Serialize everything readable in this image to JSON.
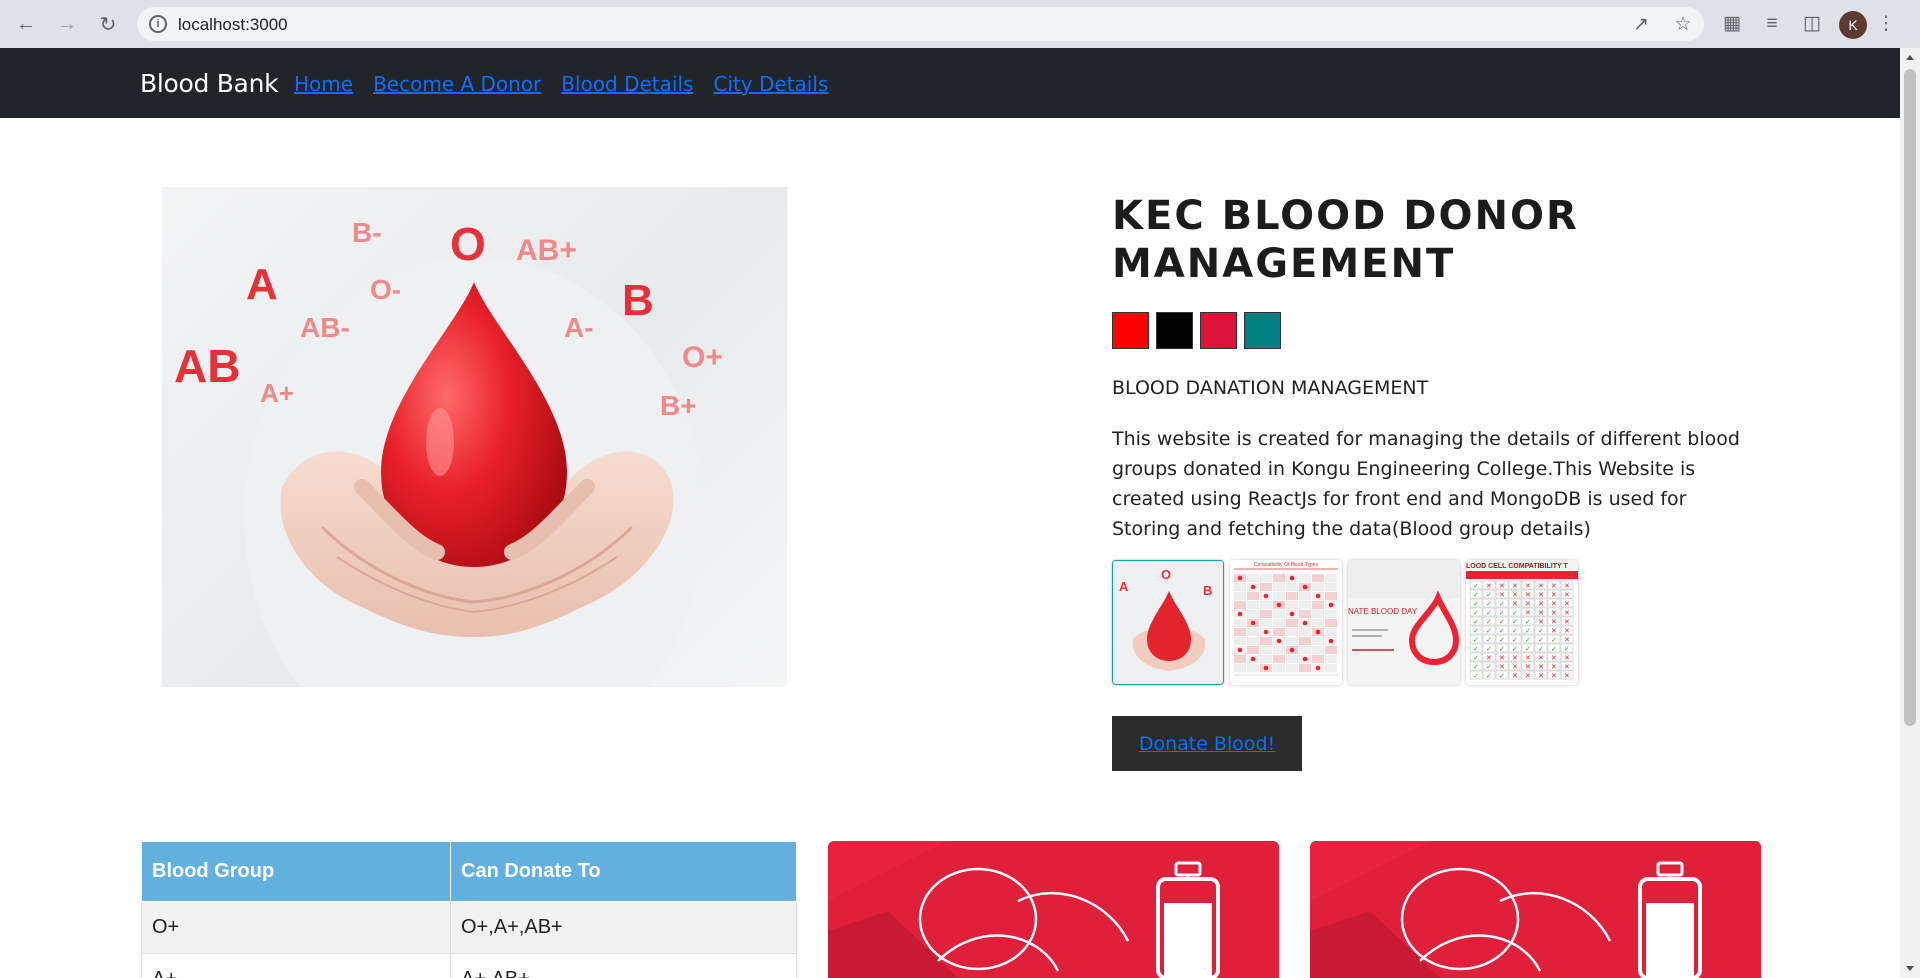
{
  "browser": {
    "url": "localhost:3000",
    "profile_initial": "K"
  },
  "site": {
    "brand": "Blood Bank",
    "nav": [
      "Home",
      "Become A Donor",
      "Blood Details",
      "City Details"
    ]
  },
  "hero": {
    "image_labels": [
      "B-",
      "O",
      "AB+",
      "A",
      "O-",
      "B",
      "AB-",
      "A-",
      "AB",
      "O+",
      "A+",
      "B+"
    ],
    "title": "KEC BLOOD DONOR MANAGEMENT",
    "swatch_colors": [
      "#ff0000",
      "#000000",
      "#dc143c",
      "#008080"
    ],
    "subtitle": "BLOOD DANATION MANAGEMENT",
    "description": "This website is created for managing the details of different blood groups donated in Kongu Engineering College.This Website is created using ReactJs for front end and MongoDB is used for Storing and fetching the data(Blood group details)",
    "thumbnails": [
      {
        "name": "blood-drop-thumbnail",
        "text": ""
      },
      {
        "name": "compatibility-chart-thumbnail",
        "text": "Compatibility Of Blood Types"
      },
      {
        "name": "donate-blood-day-thumbnail",
        "text": "NATE BLOOD DAY"
      },
      {
        "name": "cell-compatibility-thumbnail",
        "text": "LOOD CELL COMPATIBILITY T"
      }
    ],
    "donate_button": "Donate Blood!"
  },
  "table": {
    "headers": [
      "Blood Group",
      "Can Donate To"
    ],
    "rows": [
      [
        "O+",
        "O+,A+,AB+"
      ],
      [
        "A+",
        "A+,AB+"
      ]
    ]
  },
  "colors": {
    "navbar": "#212529",
    "link": "#0d6efd",
    "table_header": "#62b0dd",
    "card_red": "#e8223f"
  }
}
